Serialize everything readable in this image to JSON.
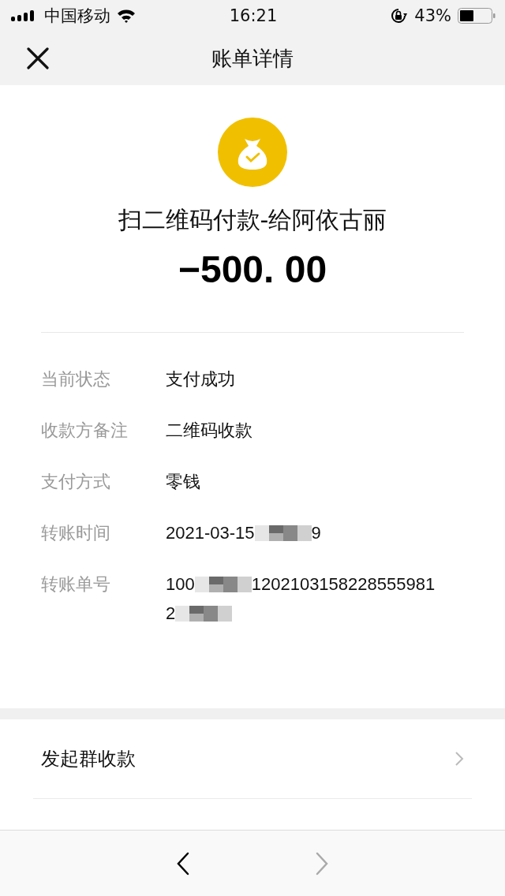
{
  "status_bar": {
    "carrier": "中国移动",
    "time": "16:21",
    "battery": "43%"
  },
  "nav": {
    "title": "账单详情"
  },
  "payment": {
    "title": "扫二维码付款-给阿依古丽",
    "amount": "−500. 00"
  },
  "details": [
    {
      "label": "当前状态",
      "parts": [
        {
          "kind": "text",
          "text": "支付成功"
        }
      ]
    },
    {
      "label": "收款方备注",
      "parts": [
        {
          "kind": "text",
          "text": "二维码收款"
        }
      ]
    },
    {
      "label": "支付方式",
      "parts": [
        {
          "kind": "text",
          "text": "零钱"
        }
      ]
    },
    {
      "label": "转账时间",
      "parts": [
        {
          "kind": "text",
          "text": "2021-03-15"
        },
        {
          "kind": "mosaic"
        },
        {
          "kind": "text",
          "text": "9"
        }
      ]
    },
    {
      "label": "转账单号",
      "parts": [
        {
          "kind": "text",
          "text": "100"
        },
        {
          "kind": "mosaic"
        },
        {
          "kind": "text",
          "text": "1202103158228555981"
        },
        {
          "kind": "break"
        },
        {
          "kind": "text",
          "text": "2"
        },
        {
          "kind": "mosaic"
        }
      ]
    }
  ],
  "actions": [
    {
      "label": "发起群收款"
    }
  ],
  "toolbar": {
    "back": {
      "disabled": false
    },
    "forward": {
      "disabled": true
    }
  }
}
